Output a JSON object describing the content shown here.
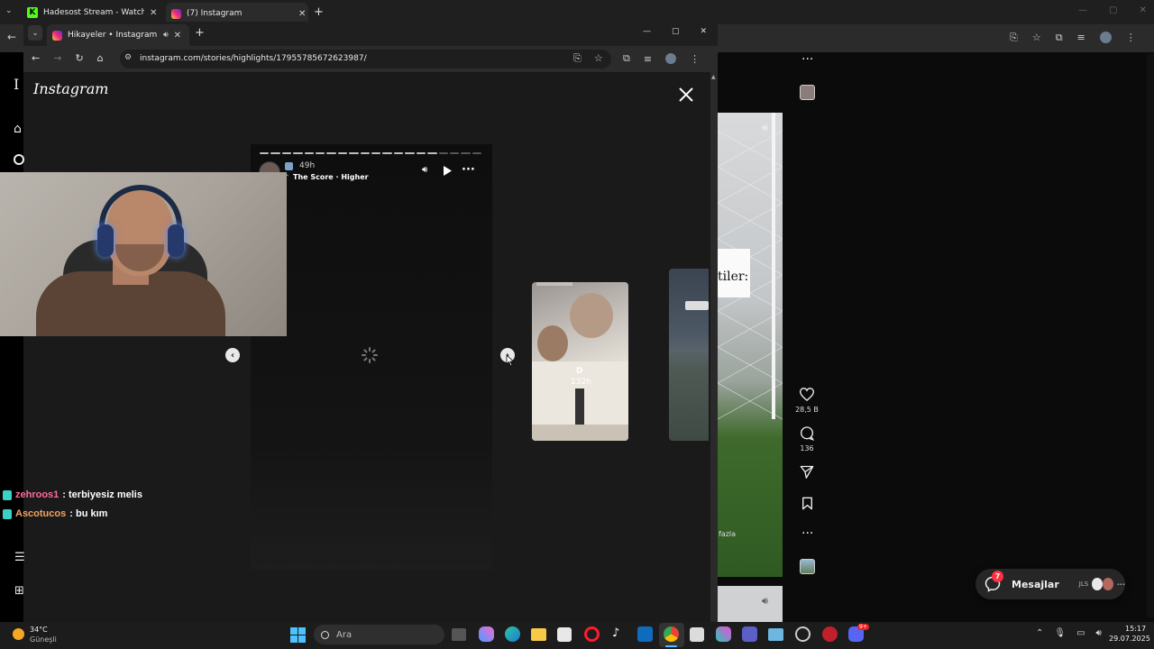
{
  "back_browser": {
    "tabs": [
      {
        "label": "Hadesost Stream - Watch Live"
      },
      {
        "label": "(7) Instagram"
      }
    ],
    "new_tab": "+"
  },
  "front_browser": {
    "tab": {
      "label": "Hikayeler • Instagram"
    },
    "new_tab": "+",
    "url": "instagram.com/stories/highlights/17955785672623987/"
  },
  "instagram": {
    "logo": "Instagram",
    "story": {
      "time_ago": "49h",
      "music": "The Score · Higher",
      "progress_total": 20,
      "progress_done": 16
    },
    "next_story": {
      "name": "D",
      "time_ago": "132h"
    },
    "close_icon": "close-icon"
  },
  "reel": {
    "overlay_text": "tiler:",
    "more_text": "fazla",
    "likes": "28,5 B",
    "comments": "136"
  },
  "messages": {
    "label": "Mesajlar",
    "badge": "7",
    "avatar_initials": "JLS"
  },
  "chat": [
    {
      "user": "zehroos1",
      "message": ": terbiyesiz melis",
      "color": "#ff6b9d"
    },
    {
      "user": "Ascotucos",
      "message": ": bu kım",
      "color": "#f4a261"
    }
  ],
  "taskbar": {
    "weather_temp": "34°C",
    "weather_desc": "Güneşli",
    "search_placeholder": "Ara",
    "time": "15:17",
    "date": "29.07.2025",
    "discord_badge": "9+"
  }
}
